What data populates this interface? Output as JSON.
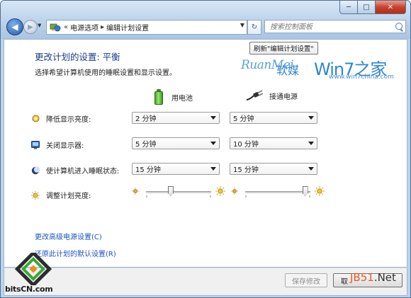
{
  "window": {
    "caption": {
      "minimize": "─",
      "maximize": "□",
      "close": "✕"
    }
  },
  "nav": {
    "back_glyph": "◀",
    "forward_glyph": "▶",
    "breadcrumb_prefix": "«",
    "breadcrumb": [
      "电源选项",
      "编辑计划设置"
    ],
    "breadcrumb_sep": "▸",
    "refresh_glyph": "↻",
    "search_placeholder": "搜索控制面板"
  },
  "tooltip": "刷新\"编辑计划设置\"",
  "main": {
    "title": "更改计划的设置: 平衡",
    "subtitle": "选择希望计算机使用的睡眠设置和显示设置。"
  },
  "watermark": {
    "ruanmei": "RuanMei",
    "ruanmei_cn": "软媒",
    "win7": "Win7之家",
    "url": "www.win7china.com"
  },
  "columns": {
    "battery": "用电池",
    "plugged": "接通电源"
  },
  "settings": [
    {
      "label": "降低显示亮度:",
      "battery": "2 分钟",
      "plugged": "5 分钟",
      "icon": "dim-display-icon"
    },
    {
      "label": "关闭显示器:",
      "battery": "5 分钟",
      "plugged": "10 分钟",
      "icon": "monitor-icon"
    },
    {
      "label": "使计算机进入睡眠状态:",
      "battery": "15 分钟",
      "plugged": "15 分钟",
      "icon": "moon-icon"
    }
  ],
  "brightness": {
    "label": "调整计划亮度:",
    "battery_level": 0.38,
    "plugged_level": 0.92
  },
  "links": {
    "advanced": "更改高级电源设置(C)",
    "restore": "还原此计划的默认设置(R)"
  },
  "footer": {
    "save": "保存修改",
    "cancel": "取",
    "jb51_a": "JB51",
    "jb51_b": ".Net"
  },
  "bitscn": {
    "text": "bitsCN.com"
  }
}
